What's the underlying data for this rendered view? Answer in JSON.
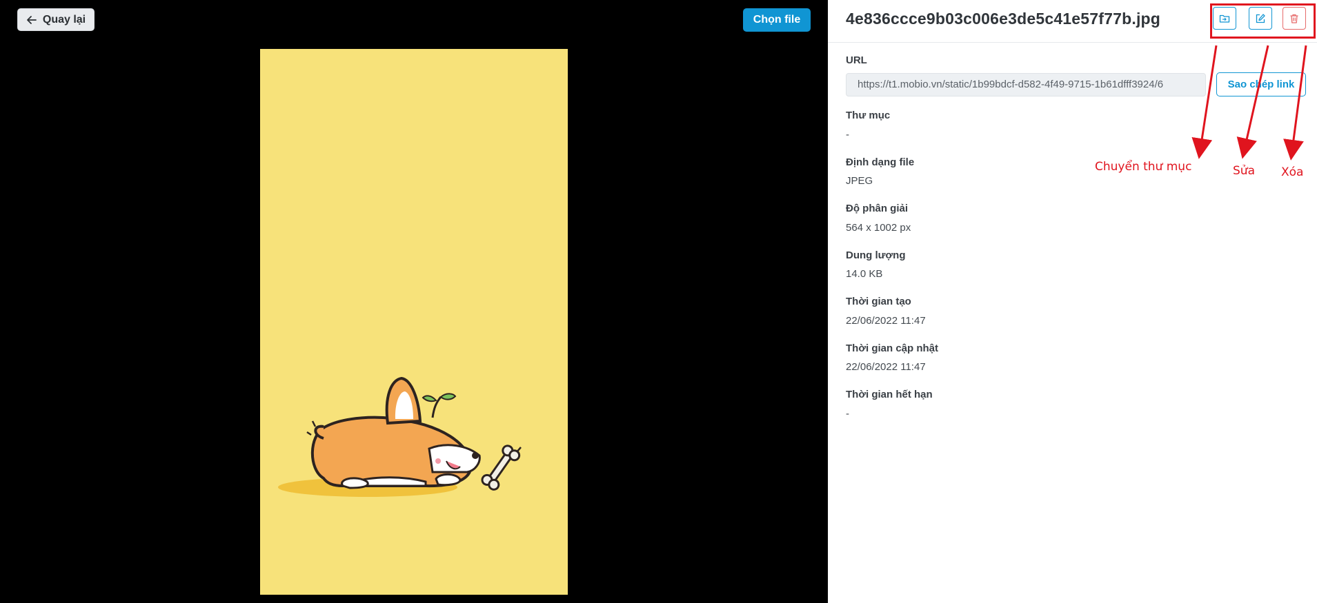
{
  "toolbar": {
    "back_label": "Quay lại",
    "choose_file_label": "Chọn file"
  },
  "file": {
    "name": "4e836ccce9b03c006e3de5c41e57f77b.jpg"
  },
  "fields": {
    "url_label": "URL",
    "url_value": "https://t1.mobio.vn/static/1b99bdcf-d582-4f49-9715-1b61dfff3924/6",
    "copy_link_label": "Sao chép link",
    "folder_label": "Thư mục",
    "folder_value": "-",
    "format_label": "Định dạng file",
    "format_value": "JPEG",
    "resolution_label": "Độ phân giải",
    "resolution_value": "564 x 1002 px",
    "size_label": "Dung lượng",
    "size_value": "14.0 KB",
    "created_label": "Thời gian tạo",
    "created_value": "22/06/2022 11:47",
    "updated_label": "Thời gian cập nhật",
    "updated_value": "22/06/2022 11:47",
    "expire_label": "Thời gian hết hạn",
    "expire_value": "-"
  },
  "annotations": {
    "move_folder": "Chuyển thư mục",
    "edit": "Sửa",
    "delete": "Xóa"
  },
  "colors": {
    "primary": "#1095d3",
    "danger": "#e0141e",
    "preview_bg": "#f7e27a"
  },
  "icons": {
    "back": "arrow-left-icon",
    "move": "folder-move-icon",
    "edit": "edit-icon",
    "delete": "trash-icon"
  }
}
